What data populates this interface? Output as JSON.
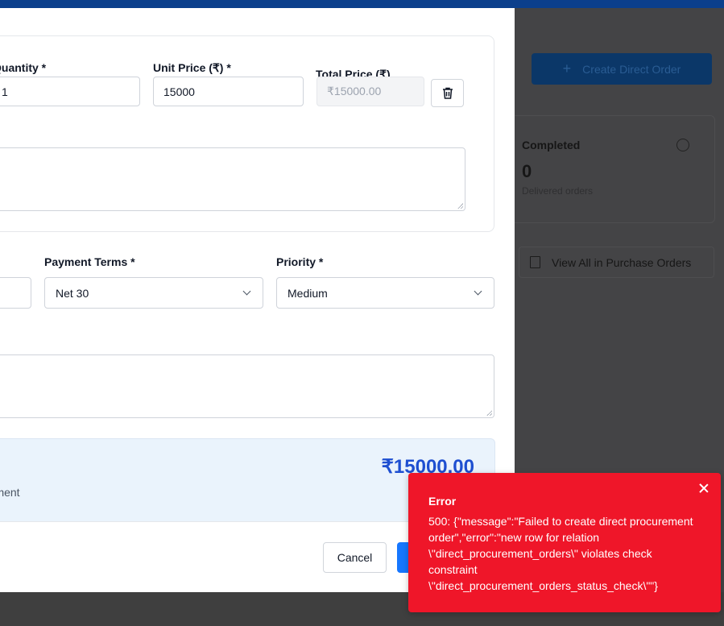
{
  "background": {
    "create_order_label": "Create Direct Order",
    "completed_card": {
      "title": "Completed",
      "count": "0",
      "subtitle": "Delivered orders"
    },
    "view_all_label": "View All in Purchase Orders"
  },
  "form": {
    "item": {
      "quantity_label": "Quantity *",
      "quantity_value": "1",
      "unit_price_label": "Unit Price (₹) *",
      "unit_price_value": "15000",
      "total_price_label": "Total Price (₹)",
      "total_price_value": "₹15000.00"
    },
    "payment_terms": {
      "label": "Payment Terms *",
      "value": "Net 30"
    },
    "priority": {
      "label": "Priority *",
      "value": "Medium"
    }
  },
  "summary": {
    "total": "₹15000.00",
    "subtitle_fragment": "rement"
  },
  "actions": {
    "cancel_label": "Cancel"
  },
  "toast": {
    "title": "Error",
    "message": "500: {\"message\":\"Failed to create direct procurement order\",\"error\":\"new row for relation \\\"direct_procurement_orders\\\" violates check constraint \\\"direct_procurement_orders_status_check\\\"\"}"
  },
  "colors": {
    "accent": "#1677ff",
    "total_text": "#1e4fd1",
    "toast_bg": "#ef1629",
    "topbar": "#0b3f8c"
  }
}
